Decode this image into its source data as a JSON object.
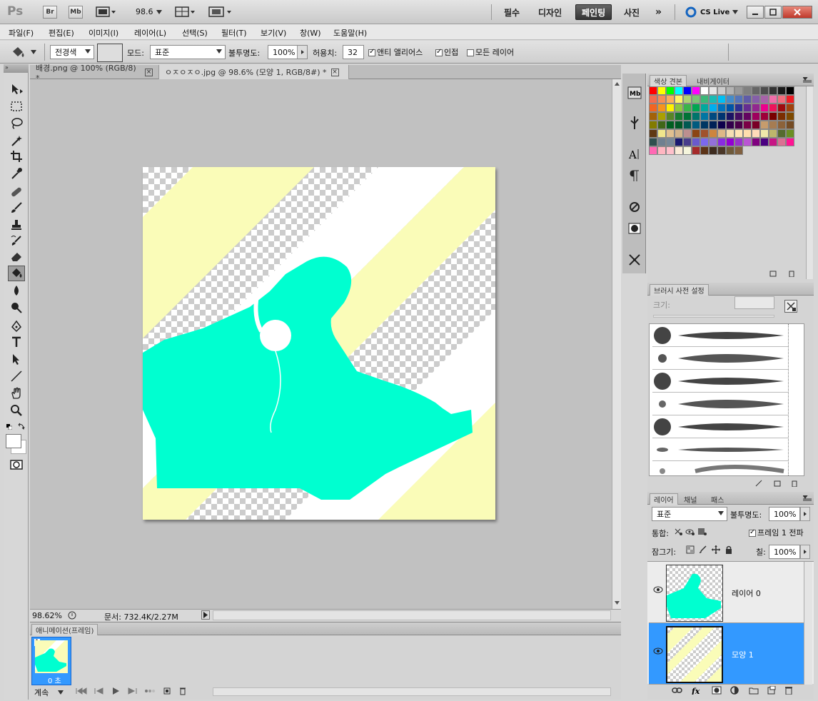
{
  "titlebar": {
    "logo": "Ps",
    "bridge_label": "Br",
    "minibridge_label": "Mb",
    "zoom": "98.6",
    "workspaces": [
      "필수",
      "디자인",
      "페인팅",
      "사진"
    ],
    "active_workspace": "페인팅",
    "more": "»",
    "cslive": "CS Live"
  },
  "menu": [
    "파일(F)",
    "편집(E)",
    "이미지(I)",
    "레이어(L)",
    "선택(S)",
    "필터(T)",
    "보기(V)",
    "창(W)",
    "도움말(H)"
  ],
  "options": {
    "fill_source": "전경색",
    "mode_label": "모드:",
    "mode_value": "표준",
    "opacity_label": "불투명도:",
    "opacity_value": "100%",
    "tolerance_label": "허용치:",
    "tolerance_value": "32",
    "antialias_label": "앤티 앨리어스",
    "contiguous_label": "인접",
    "all_layers_label": "모든 레이어"
  },
  "tabs": [
    {
      "label": "배경.png @ 100% (RGB/8) *",
      "active": false
    },
    {
      "label": "ㅇㅈㅇㅈㅇ.jpg @ 98.6% (모양 1, RGB/8#) *",
      "active": true
    }
  ],
  "status": {
    "zoom": "98.62%",
    "doc": "문서: 732.4K/2.27M"
  },
  "animation": {
    "title": "애니메이션(프레임)",
    "frame_number": "1",
    "frame_delay": "0 초",
    "loop": "계속"
  },
  "panels": {
    "swatches_tab": "색상 견본",
    "navigator_tab": "내비게이터",
    "brush_tab": "브러시 사전 설정",
    "size_label": "크기:",
    "layers_tab": "레이어",
    "channels_tab": "채널",
    "paths_tab": "패스",
    "blend_mode": "표준",
    "opacity_label": "불투명도:",
    "opacity_value": "100%",
    "unify_label": "통합:",
    "propagate_label": "프레임 1 전파",
    "lock_label": "잠그기:",
    "fill_label": "칠:",
    "fill_value": "100%",
    "layers": [
      {
        "name": "레이어 0",
        "selected": false
      },
      {
        "name": "모양 1",
        "selected": true
      }
    ]
  },
  "colors": {
    "accent": "#3399ff",
    "figure": "#00ffd0",
    "stripe": "#fafcb8"
  },
  "swatch_colors": [
    "#ff0000",
    "#ffff00",
    "#00ff00",
    "#00ffff",
    "#0000ff",
    "#ff00ff",
    "#ffffff",
    "#e6e6e6",
    "#cccccc",
    "#b3b3b3",
    "#999999",
    "#808080",
    "#666666",
    "#4d4d4d",
    "#333333",
    "#1a1a1a",
    "#000000",
    "#f26c4f",
    "#f68e55",
    "#fbaf5c",
    "#fff467",
    "#acd372",
    "#7cc576",
    "#3bb878",
    "#1abbb4",
    "#00bff3",
    "#438cca",
    "#5574b9",
    "#605ca8",
    "#855fa8",
    "#a763a8",
    "#f06ea9",
    "#f26d7d",
    "#ed1c24",
    "#f26522",
    "#f7941d",
    "#fff200",
    "#8dc73f",
    "#39b54a",
    "#00a651",
    "#00a99d",
    "#00aeef",
    "#0072bc",
    "#0054a6",
    "#2e3192",
    "#662d91",
    "#92278f",
    "#ec008c",
    "#ed145b",
    "#9e0b0f",
    "#a0410d",
    "#a36209",
    "#aba000",
    "#598527",
    "#197b30",
    "#007236",
    "#00746b",
    "#0076a3",
    "#004a80",
    "#003471",
    "#1b1464",
    "#440e62",
    "#630460",
    "#9e005d",
    "#9e0039",
    "#790000",
    "#7b2e00",
    "#7d4900",
    "#827b00",
    "#406618",
    "#005e20",
    "#005826",
    "#005952",
    "#005b7f",
    "#003663",
    "#002157",
    "#0d004c",
    "#32004b",
    "#4b0049",
    "#7b0046",
    "#7a0026",
    "#c69c6d",
    "#a67c52",
    "#8c6239",
    "#754c24",
    "#603913",
    "#f0e68c",
    "#e0c090",
    "#d2b48c",
    "#bc8f8f",
    "#8b4513",
    "#a0522d",
    "#cd853f",
    "#deb887",
    "#f5deb3",
    "#ffe4b5",
    "#ffdead",
    "#ffdab9",
    "#eee8aa",
    "#bdb76b",
    "#556b2f",
    "#6b8e23",
    "#2f4f4f",
    "#708090",
    "#778899",
    "#191970",
    "#483d8b",
    "#6a5acd",
    "#7b68ee",
    "#9370db",
    "#8a2be2",
    "#9400d3",
    "#9932cc",
    "#ba55d3",
    "#800080",
    "#4b0082",
    "#c71585",
    "#db7093",
    "#ff1493",
    "#ff69b4",
    "#ffb6c1",
    "#ffc0cb",
    "#faebd7",
    "#f5f5dc",
    "#a52a2a",
    "#5c3317",
    "#3d2b1f",
    "#4a3728",
    "#6e5a3b",
    "#806040"
  ]
}
